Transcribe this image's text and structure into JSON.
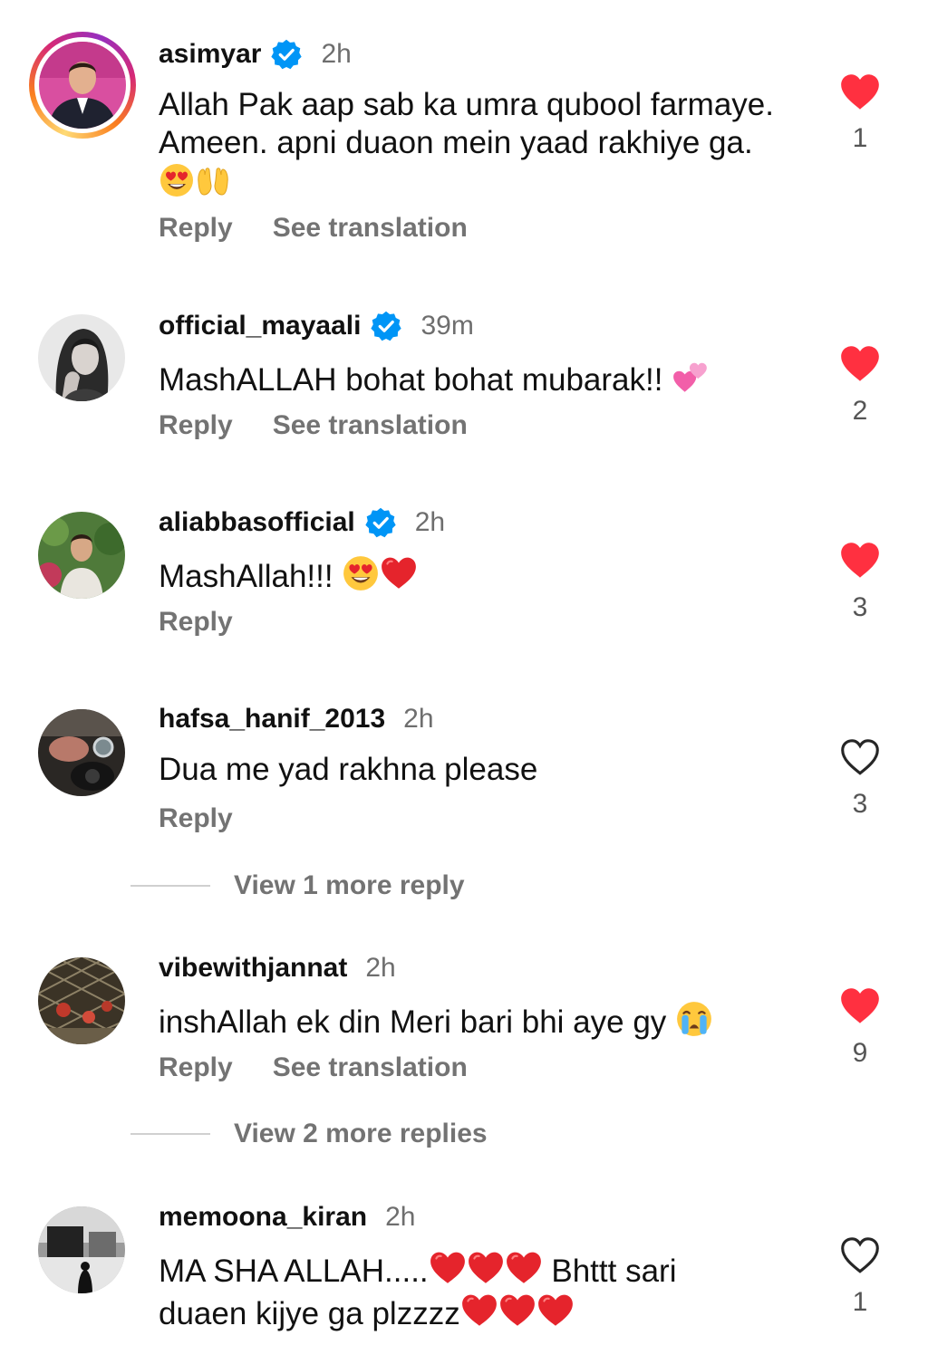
{
  "comments": [
    {
      "username": "asimyar",
      "verified": true,
      "time": "2h",
      "text": "Allah Pak aap sab ka umra qubool farmaye. Ameen. apni duaon mein yaad rakhiye ga.",
      "emojis": [
        "smiling-face-with-heart-eyes",
        "palms-up-together"
      ],
      "reply_label": "Reply",
      "translation_label": "See translation",
      "liked": true,
      "likes": "1"
    },
    {
      "username": "official_mayaali",
      "verified": true,
      "time": "39m",
      "text": "MashALLAH bohat bohat mubarak!!",
      "emojis": [
        "two-hearts"
      ],
      "reply_label": "Reply",
      "translation_label": "See translation",
      "liked": true,
      "likes": "2"
    },
    {
      "username": "aliabbasofficial",
      "verified": true,
      "time": "2h",
      "text": "MashAllah!!!",
      "emojis": [
        "smiling-face-with-heart-eyes",
        "red-heart"
      ],
      "reply_label": "Reply",
      "liked": true,
      "likes": "3"
    },
    {
      "username": "hafsa_hanif_2013",
      "verified": false,
      "time": "2h",
      "text": "Dua me yad rakhna please",
      "reply_label": "Reply",
      "liked": false,
      "likes": "3",
      "view_more": "View 1 more reply"
    },
    {
      "username": "vibewithjannat",
      "verified": false,
      "time": "2h",
      "text": "inshAllah ek din Meri bari bhi aye gy",
      "emojis": [
        "loudly-crying-face"
      ],
      "reply_label": "Reply",
      "translation_label": "See translation",
      "liked": true,
      "likes": "9",
      "view_more": "View 2 more replies"
    },
    {
      "username": "memoona_kiran",
      "verified": false,
      "time": "2h",
      "text_line1_a": "MA SHA ALLAH.....",
      "text_line1_b": " Bhttt sari",
      "text_line2": "duaen kijye ga plzzzz",
      "emojis": [
        "red-heart",
        "red-heart",
        "red-heart"
      ],
      "liked": false,
      "likes": "1"
    }
  ],
  "colors": {
    "heart_red": "#ff3040",
    "verified_blue": "#0095f6",
    "secondary_text": "#737373"
  }
}
